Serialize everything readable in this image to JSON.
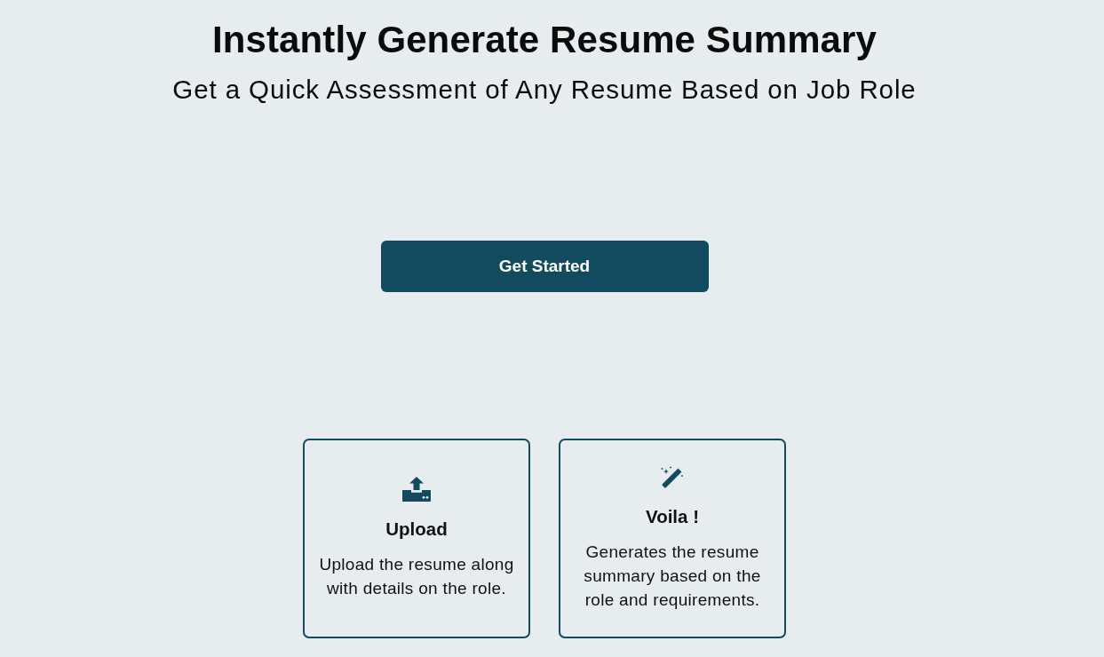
{
  "header": {
    "title": "Instantly Generate Resume Summary",
    "subtitle": "Get a Quick Assessment of Any Resume Based on Job Role"
  },
  "cta": {
    "label": "Get Started"
  },
  "steps": [
    {
      "kind": "upload",
      "title": "Upload",
      "description": "Upload the resume along with details on the role."
    },
    {
      "kind": "generate",
      "title": "Voila !",
      "description": "Generates the resume summary based on the role and requirements."
    }
  ]
}
